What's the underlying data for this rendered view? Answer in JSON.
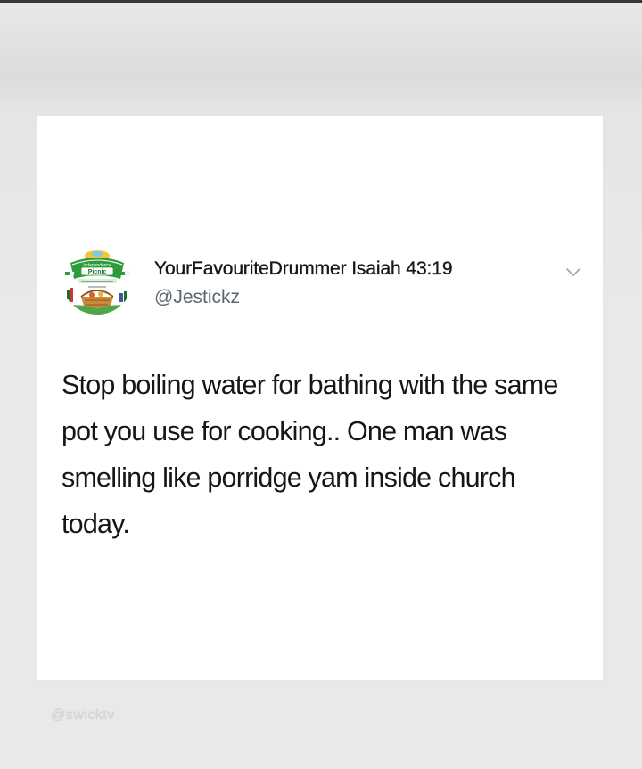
{
  "tweet": {
    "display_name": "YourFavouriteDrummer Isaiah 43:19",
    "handle": "@Jestickz",
    "text": "Stop boiling water for bathing with the same pot you use for cooking.. One man was smelling like porridge yam inside church today.",
    "avatar_icon": "independence-picnic-logo-avatar",
    "avatar_logo_text": "Independence Picnic",
    "menu_icon": "chevron-down-icon"
  },
  "watermark": "@swicktv",
  "colors": {
    "text_primary": "#14171a",
    "text_secondary": "#5b6670",
    "card_background": "#ffffff",
    "page_background": "#e9e9e9"
  }
}
